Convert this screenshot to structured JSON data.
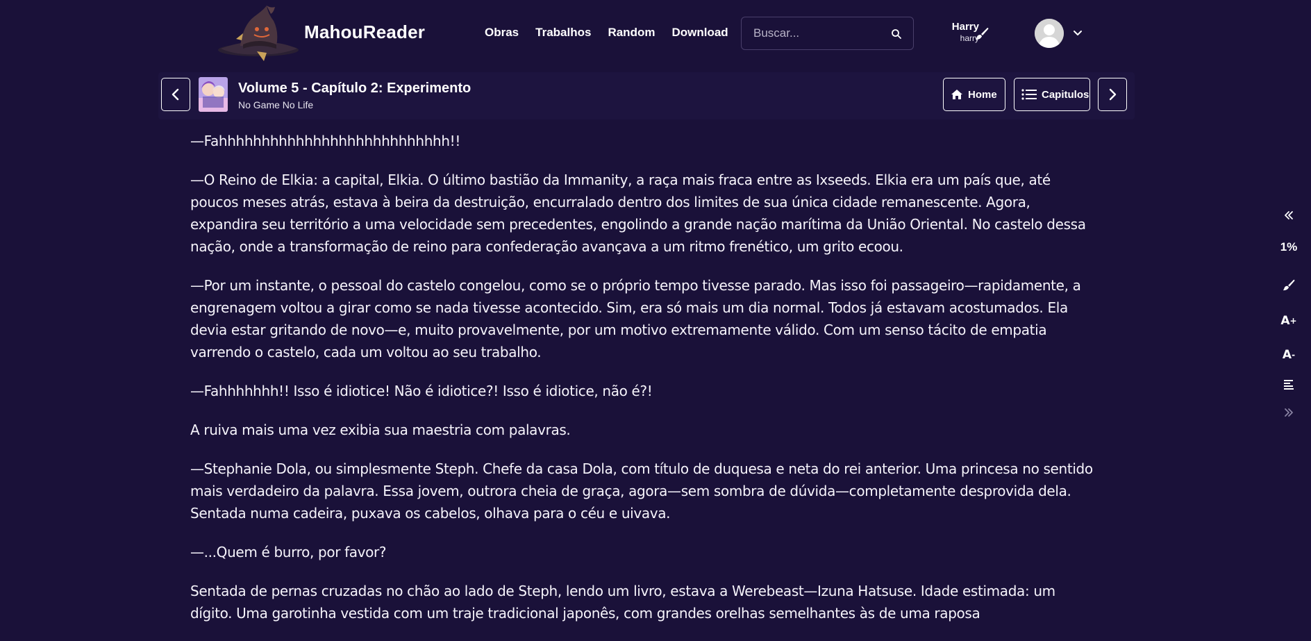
{
  "header": {
    "brand": "MahouReader",
    "nav": [
      "Obras",
      "Trabalhos",
      "Random",
      "Download"
    ],
    "search_placeholder": "Buscar...",
    "user": {
      "name": "Harry",
      "username": "harry"
    }
  },
  "chapter": {
    "title": "Volume 5 - Capítulo 2: Experimento",
    "series": "No Game No Life",
    "home_label": "Home",
    "chapters_label": "Capitulos"
  },
  "reader": {
    "paragraphs": [
      "—Fahhhhhhhhhhhhhhhhhhhhhhhhhhh!!",
      "—O Reino de Elkia: a capital, Elkia. O último bastião da Immanity, a raça mais fraca entre as Ixseeds. Elkia era um país que, até poucos meses atrás, estava à beira da destruição, encurralado dentro dos limites de sua única cidade remanescente. Agora, expandira seu território a uma velocidade sem precedentes, engolindo a grande nação marítima da União Oriental. No castelo dessa nação, onde a transformação de reino para confederação avançava a um ritmo frenético, um grito ecoou.",
      "—Por um instante, o pessoal do castelo congelou, como se o próprio tempo tivesse parado. Mas isso foi passageiro—rapidamente, a engrenagem voltou a girar como se nada tivesse acontecido. Sim, era só mais um dia normal. Todos já estavam acostumados. Ela devia estar gritando de novo—e, muito provavelmente, por um motivo extremamente válido. Com um senso tácito de empatia varrendo o castelo, cada um voltou ao seu trabalho.",
      "—Fahhhhhhh!! Isso é idiotice! Não é idiotice?! Isso é idiotice, não é?!",
      "A ruiva mais uma vez exibia sua maestria com palavras.",
      "—Stephanie Dola, ou simplesmente Steph. Chefe da casa Dola, com título de duquesa e neta do rei anterior. Uma princesa no sentido mais verdadeiro da palavra. Essa jovem, outrora cheia de graça, agora—sem sombra de dúvida—completamente desprovida dela. Sentada numa cadeira, puxava os cabelos, olhava para o céu e uivava.",
      "—...Quem é burro, por favor?",
      "Sentada de pernas cruzadas no chão ao lado de Steph, lendo um livro, estava a Werebeast—Izuna Hatsuse. Idade estimada: um dígito. Uma garotinha vestida com um traje tradicional japonês, com grandes orelhas semelhantes às de uma raposa"
    ]
  },
  "toolbar": {
    "progress": "1%",
    "font_increase": "A",
    "font_increase_sign": "+",
    "font_decrease": "A",
    "font_decrease_sign": "-"
  },
  "colors": {
    "background": "#1a1139",
    "text": "#f6f4fb",
    "border": "#ffffff"
  }
}
